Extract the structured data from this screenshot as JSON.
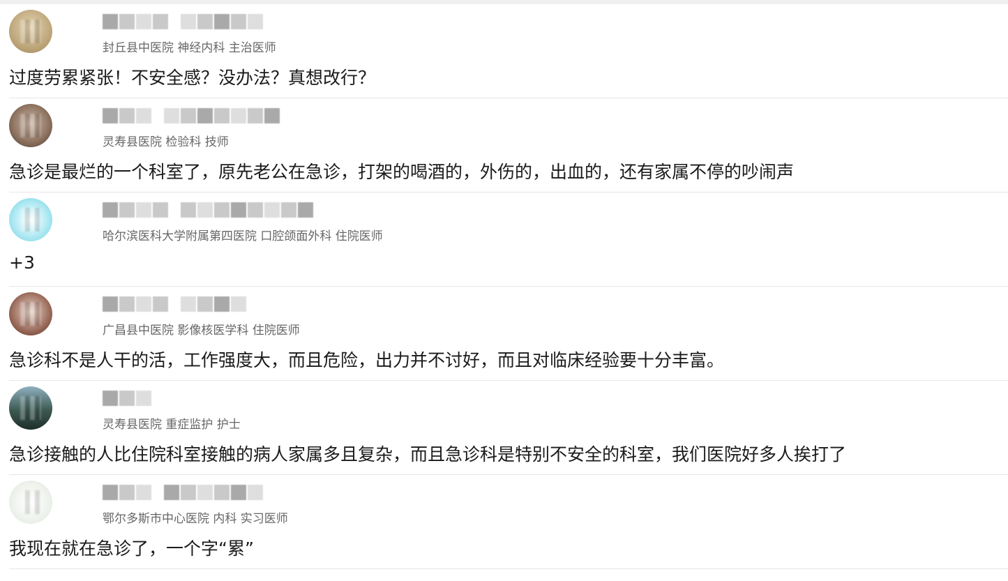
{
  "comments": [
    {
      "meta": "封丘县中医院 神经内科 主治医师",
      "text": "过度劳累紧张！不安全感？没办法？真想改行？",
      "avatar_color": "#c9b48a"
    },
    {
      "meta": "灵寿县医院 检验科 技师",
      "text": "急诊是最烂的一个科室了，原先老公在急诊，打架的喝酒的，外伤的，出血的，还有家属不停的吵闹声",
      "avatar_color": "#8a6f5c"
    },
    {
      "meta": "哈尔滨医科大学附属第四医院 口腔颌面外科 住院医师",
      "text": "+3",
      "avatar_color": "#7fd6e6"
    },
    {
      "meta": "广昌县中医院 影像核医学科 住院医师",
      "text": "急诊科不是人干的活，工作强度大，而且危险，出力并不讨好，而且对临床经验要十分丰富。",
      "avatar_color": "#9a6a5a"
    },
    {
      "meta": "灵寿县医院 重症监护 护士",
      "text": "急诊接触的人比住院科室接触的病人家属多且复杂，而且急诊科是特别不安全的科室，我们医院好多人挨打了",
      "avatar_color": "#3d5a52"
    },
    {
      "meta": "鄂尔多斯市中心医院 内科 实习医师",
      "text": "我现在就在急诊了，一个字“累”",
      "avatar_color": "#e8ede6"
    }
  ]
}
